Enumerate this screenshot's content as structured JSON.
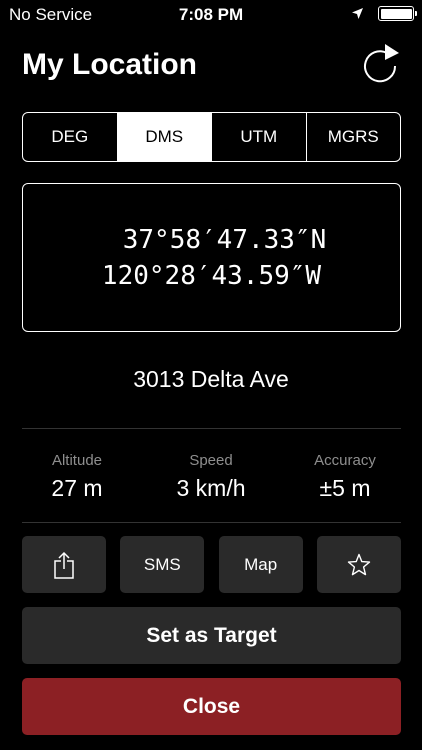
{
  "status_bar": {
    "carrier": "No Service",
    "time": "7:08 PM",
    "battery_level": 1.0
  },
  "header": {
    "title": "My Location",
    "refresh_icon": "refresh-icon"
  },
  "format_tabs": [
    {
      "label": "DEG",
      "selected": false
    },
    {
      "label": "DMS",
      "selected": true
    },
    {
      "label": "UTM",
      "selected": false
    },
    {
      "label": "MGRS",
      "selected": false
    }
  ],
  "coordinates": {
    "latitude": "37°58′47.33″N",
    "longitude": "120°28′43.59″W"
  },
  "address": "3013 Delta Ave",
  "stats": [
    {
      "label": "Altitude",
      "value": "27 m"
    },
    {
      "label": "Speed",
      "value": "3 km/h"
    },
    {
      "label": "Accuracy",
      "value": "±5 m"
    }
  ],
  "actions": {
    "share_icon": "share-icon",
    "sms_label": "SMS",
    "map_label": "Map",
    "favorite_icon": "star-icon"
  },
  "buttons": {
    "set_target": "Set as Target",
    "close": "Close"
  },
  "colors": {
    "background": "#000000",
    "button": "#2a2a2a",
    "close_button": "#8c2024",
    "label_gray": "#8e8e8e"
  }
}
